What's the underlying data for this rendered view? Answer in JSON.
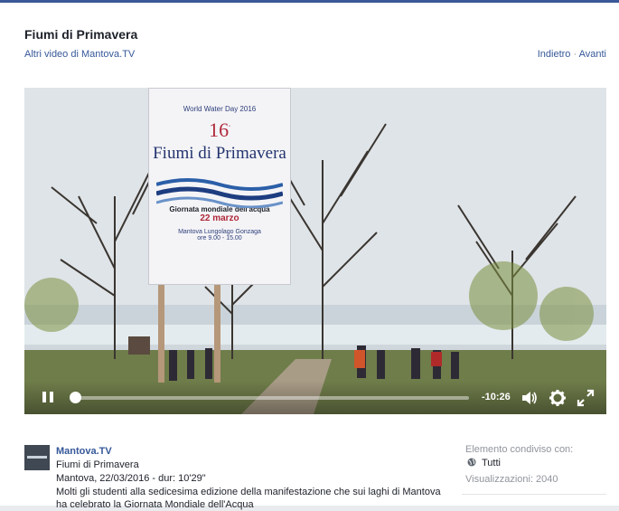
{
  "header": {
    "title": "Fiumi di Primavera",
    "more_videos": "Altri video di Mantova.TV",
    "nav_prev": "Indietro",
    "nav_separator": "·",
    "nav_next": "Avanti"
  },
  "video": {
    "sign": {
      "event": "World Water Day 2016",
      "edition": "16",
      "edition_suffix": "ª",
      "name": "Fiumi di Primavera",
      "subtitle": "Giornata mondiale dell'acqua",
      "date": "22 marzo",
      "location": "Mantova Lungolago Gonzaga",
      "hours": "ore 9.00 - 15.00"
    },
    "controls": {
      "time_remaining": "-10:26",
      "progress": 0.0
    }
  },
  "post": {
    "page_name": "Mantova.TV",
    "video_title": "Fiumi di Primavera",
    "meta": "Mantova, 22/03/2016 - dur: 10'29\"",
    "description": "Molti gli studenti alla sedicesima edizione della manifestazione che sui laghi di Mantova ha celebrato la Giornata Mondiale dell'Acqua"
  },
  "sidebar": {
    "shared_with_label": "Elemento condiviso con:",
    "audience": "Tutti",
    "views": "Visualizzazioni: 2040"
  },
  "colors": {
    "accent": "#3b5998",
    "link": "#365899",
    "muted": "#90949c"
  }
}
